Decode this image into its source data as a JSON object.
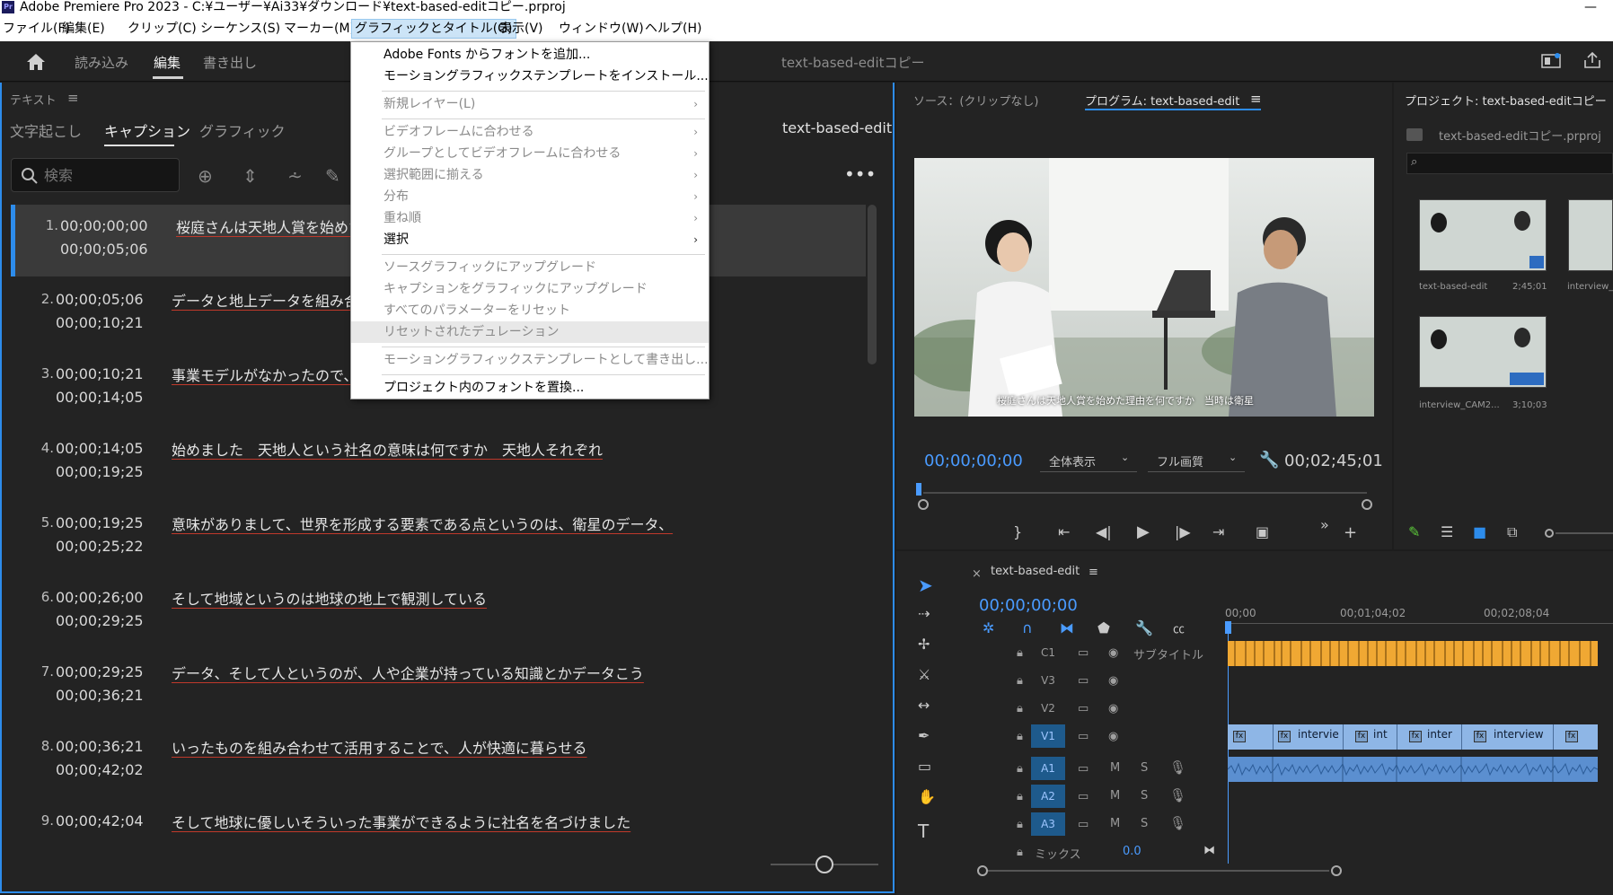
{
  "window": {
    "title": "Adobe Premiere Pro 2023 - C:¥ユーザー¥Ai33¥ダウンロード¥text-based-editコピー.prproj",
    "app_logo": "Pr"
  },
  "menubar": {
    "items": [
      {
        "label": "ファイル(F)"
      },
      {
        "label": "編集(E)"
      },
      {
        "label": "クリップ(C)"
      },
      {
        "label": "シーケンス(S)"
      },
      {
        "label": "マーカー(M)"
      },
      {
        "label": "グラフィックとタイトル(G)",
        "active": true
      },
      {
        "label": "表示(V)"
      },
      {
        "label": "ウィンドウ(W)"
      },
      {
        "label": "ヘルプ(H)"
      }
    ]
  },
  "header": {
    "tabs": [
      {
        "label": "読み込み"
      },
      {
        "label": "編集",
        "active": true
      },
      {
        "label": "書き出し"
      }
    ],
    "document_title": "text-based-editコピー"
  },
  "dropdown": {
    "items": [
      {
        "label": "Adobe Fonts からフォントを追加...",
        "disabled": false
      },
      {
        "label": "モーショングラフィックステンプレートをインストール...",
        "disabled": false
      },
      {
        "label": "新規レイヤー(L)",
        "disabled": true,
        "submenu": true
      },
      {
        "label": "ビデオフレームに合わせる",
        "disabled": true,
        "submenu": true
      },
      {
        "label": "グループとしてビデオフレームに合わせる",
        "disabled": true,
        "submenu": true
      },
      {
        "label": "選択範囲に揃える",
        "disabled": true,
        "submenu": true
      },
      {
        "label": "分布",
        "disabled": true,
        "submenu": true
      },
      {
        "label": "重ね順",
        "disabled": true,
        "submenu": true
      },
      {
        "label": "選択",
        "disabled": false,
        "submenu": true
      },
      {
        "label": "ソースグラフィックにアップグレード",
        "disabled": true
      },
      {
        "label": "キャプションをグラフィックにアップグレード",
        "disabled": true
      },
      {
        "label": "すべてのパラメーターをリセット",
        "disabled": true
      },
      {
        "label": "リセットされたデュレーション",
        "disabled": true
      },
      {
        "label": "モーショングラフィックステンプレートとして書き出し...",
        "disabled": true
      },
      {
        "label": "プロジェクト内のフォントを置換...",
        "disabled": false
      }
    ]
  },
  "text_panel": {
    "title": "テキスト",
    "tabs": [
      {
        "label": "文字起こし"
      },
      {
        "label": "キャプション",
        "active": true
      },
      {
        "label": "グラフィック"
      }
    ],
    "sequence_name": "text-based-edit",
    "search": {
      "placeholder": "検索"
    },
    "captions": [
      {
        "num": "1.",
        "in": "00;00;00;00",
        "out": "00;00;05;06",
        "text": "桜庭さんは天地人賞を始めた",
        "selected": true
      },
      {
        "num": "2.",
        "in": "00;00;05;06",
        "out": "00;00;10;21",
        "text": "データと地上データを組み合わ"
      },
      {
        "num": "3.",
        "in": "00;00;10;21",
        "out": "00;00;14;05",
        "text": "事業モデルがなかったので、こ"
      },
      {
        "num": "4.",
        "in": "00;00;14;05",
        "out": "00;00;19;25",
        "text": "始めました　天地人という社名の意味は何ですか　天地人それぞれ"
      },
      {
        "num": "5.",
        "in": "00;00;19;25",
        "out": "00;00;25;22",
        "text": "意味がありまして、世界を形成する要素である点というのは、衛星のデータ、"
      },
      {
        "num": "6.",
        "in": "00;00;26;00",
        "out": "00;00;29;25",
        "text": "そして地域というのは地球の地上で観測している"
      },
      {
        "num": "7.",
        "in": "00;00;29;25",
        "out": "00;00;36;21",
        "text": "データ、そして人というのが、人や企業が持っている知識とかデータこう"
      },
      {
        "num": "8.",
        "in": "00;00;36;21",
        "out": "00;00;42;02",
        "text": "いったものを組み合わせて活用することで、人が快適に暮らせる"
      },
      {
        "num": "9.",
        "in": "00;00;42;04",
        "out": "",
        "text": "そして地球に優しいそういった事業ができるように社名を名づけました"
      }
    ]
  },
  "monitor": {
    "source_tab": "ソース：(クリップなし)",
    "program_tab": "プログラム: text-based-edit",
    "subtitle_overlay": "桜庭さんは天地人賞を始めた理由を何ですか　当時は衛星",
    "current_tc": "00;00;00;00",
    "zoom_select": "全体表示",
    "quality_select": "フル画質",
    "duration_tc": "00;02;45;01"
  },
  "project": {
    "title": "プロジェクト: text-based-editコピー",
    "file": "text-based-editコピー.prproj",
    "items": [
      {
        "name": "text-based-edit",
        "duration": "2;45;01"
      },
      {
        "name": "interview_",
        "duration": ""
      },
      {
        "name": "interview_CAM2...",
        "duration": "3;10;03"
      }
    ]
  },
  "timeline": {
    "sequence_tab": "text-based-edit",
    "current_tc": "00;00;00;00",
    "ruler": [
      "00;00",
      "00;01;04;02",
      "00;02;08;04"
    ],
    "tracks": [
      {
        "id": "C1",
        "name": "サブタイトル"
      },
      {
        "id": "V3",
        "name": ""
      },
      {
        "id": "V2",
        "name": ""
      },
      {
        "id": "V1",
        "name": "",
        "selected": true
      },
      {
        "id": "A1",
        "name": "",
        "selected": true
      },
      {
        "id": "A2",
        "name": "",
        "selected": true
      },
      {
        "id": "A3",
        "name": "",
        "selected": true
      }
    ],
    "mix_label": "ミックス",
    "mix_value": "0.0",
    "clip_labels": [
      "intervie",
      "int",
      "inter",
      "interview"
    ],
    "track_buttons": {
      "mute": "M",
      "solo": "S"
    }
  },
  "colors": {
    "accent": "#2d8ceb",
    "timecode": "#4a9bff",
    "caption_track": "#f0a833",
    "video_clip": "#8eb6e6",
    "audio_clip": "#5b8fd0"
  }
}
